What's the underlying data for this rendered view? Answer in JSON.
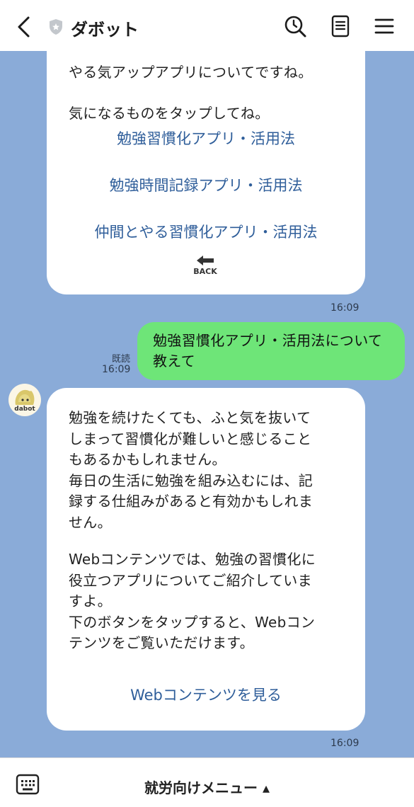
{
  "header": {
    "title": "ダボット",
    "back_icon": "chevron-left-icon",
    "verified_icon": "shield-star-icon",
    "search_icon": "search-history-icon",
    "notes_icon": "note-icon",
    "menu_icon": "hamburger-menu-icon"
  },
  "messages": {
    "menu_card": {
      "intro_line1": "やる気アップアプリについてですね。",
      "intro_line2": "気になるものをタップしてね。",
      "options": [
        "勉強習慣化アプリ・活用法",
        "勉強時間記録アプリ・活用法",
        "仲間とやる習慣化アプリ・活用法"
      ],
      "back_label": "BACK",
      "time": "16:09"
    },
    "user_message": {
      "text": "勉強習慣化アプリ・活用法について教えて",
      "read_label": "既読",
      "time": "16:09"
    },
    "bot_reply": {
      "avatar_label": "dabot",
      "paragraph1": "勉強を続けたくても、ふと気を抜いて\nしまって習慣化が難しいと感じること\nもあるかもしれません。\n毎日の生活に勉強を組み込むには、記\n録する仕組みがあると有効かもしれま\nせん。",
      "paragraph2": "Webコンテンツでは、勉強の習慣化に\n役立つアプリについてご紹介していま\nすよ。\n下のボタンをタップすると、Webコン\nテンツをご覧いただけます。",
      "link_label": "Webコンテンツを見る",
      "time": "16:09"
    }
  },
  "bottom_bar": {
    "keyboard_icon": "keyboard-icon",
    "menu_label": "就労向けメニュー ▴"
  },
  "colors": {
    "chat_background": "#8aabd8",
    "user_bubble": "#6ee578",
    "link_text": "#2f5e9a"
  }
}
